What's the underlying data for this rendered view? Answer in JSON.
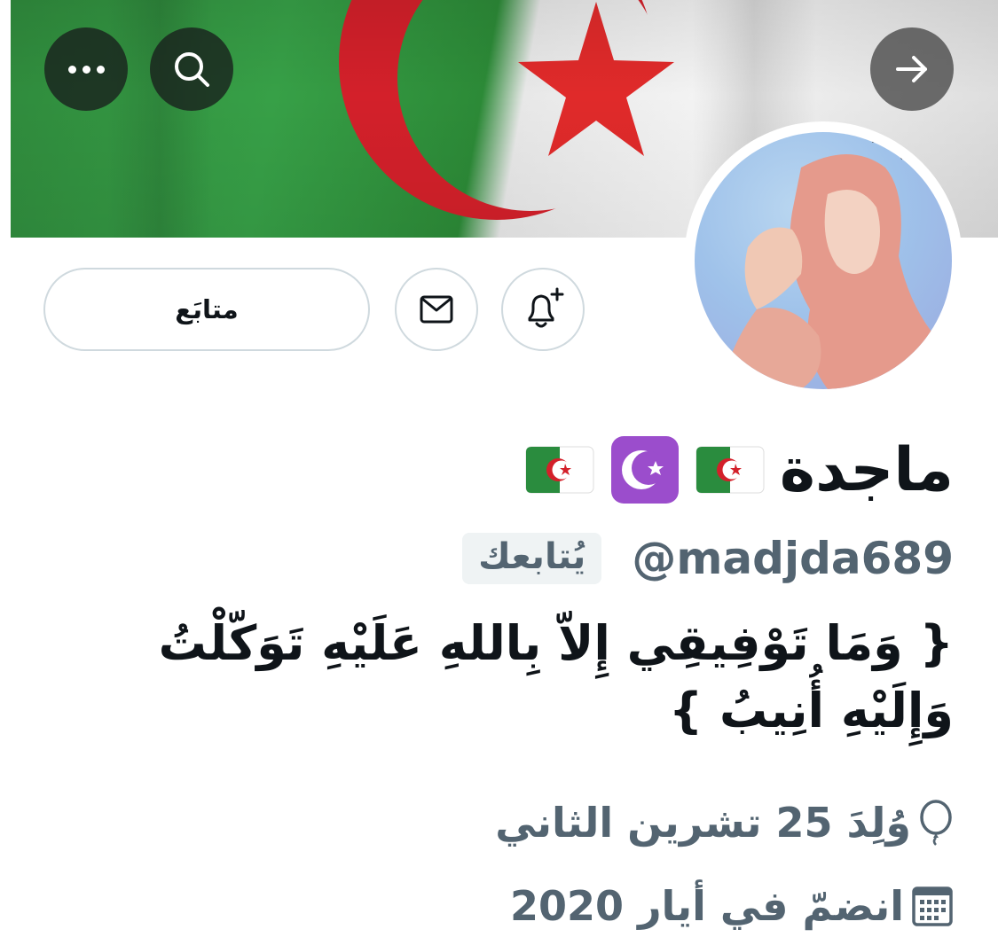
{
  "header": {
    "more_icon": "more-horizontal-icon",
    "search_icon": "search-icon",
    "back_icon": "arrow-right-icon"
  },
  "banner": {
    "description_colors": {
      "green": "#2f8a3c",
      "white": "#f2f2f2",
      "red": "#d3202a"
    }
  },
  "actions": {
    "follow_label": "متابَع",
    "message_icon": "mail-icon",
    "notify_icon": "bell-plus-icon"
  },
  "profile": {
    "display_name": "ماجدة",
    "handle": "@madjda689",
    "follows_you": "يُتابعك",
    "bio": "{ وَمَا تَوْفِيقِي إِلاّ بِاللهِ عَلَيْهِ تَوَكّلْتُ وَإِلَيْهِ أُنِيبُ }",
    "birth": "وُلِدَ 25 تشرين الثاني",
    "joined": "انضمّ في أيار 2020"
  },
  "colors": {
    "primary_text": "#0f1419",
    "secondary_text": "#536471",
    "border": "#cfd9de",
    "badge_bg": "#eff3f4"
  }
}
